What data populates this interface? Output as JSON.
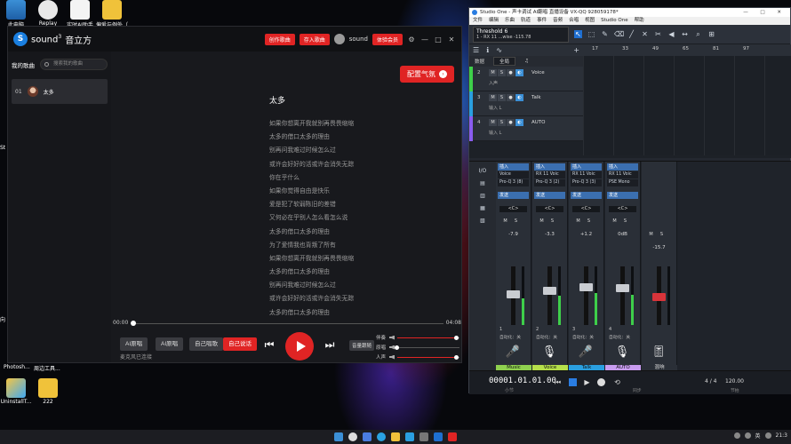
{
  "desktop": {
    "icons": [
      {
        "label": "此电脑"
      },
      {
        "label": "Replay"
      },
      {
        "label": "实时AI助手"
      },
      {
        "label": "偏爱与例外（"
      }
    ],
    "bottom_labels": [
      "Photosh...",
      "周边工具..."
    ],
    "bottom_icons": [
      {
        "label": "UninstallT..."
      },
      {
        "label": "222"
      }
    ],
    "side_letters": [
      "St",
      "向"
    ]
  },
  "sound3": {
    "brand": "sound",
    "brand_sup": "3",
    "app_name": "音立方",
    "header_buttons": [
      "创作歌曲",
      "存入歌曲"
    ],
    "user_name": "sound",
    "vip_button": "体验会员",
    "window_controls": [
      "—",
      "□",
      "✕"
    ],
    "sidebar": {
      "title": "我的歌曲",
      "search_placeholder": "搜索我的歌曲",
      "songs": [
        {
          "num": "01",
          "name": "太多"
        }
      ]
    },
    "config_button": "配置气氛",
    "song_title": "太多",
    "lyrics": [
      "如果你想离开我就别再畏畏缩缩",
      "太多的借口太多的理由",
      "别再问我难过时候怎么过",
      "或许会好好的活或许会消失无踪",
      "你在乎什么",
      "如果你觉得自由是快乐",
      "爱是犯了软弱陈旧的差错",
      "又何必在乎别人怎么看怎么说",
      "太多的借口太多的理由",
      "为了爱情我也背叛了所有",
      "如果你想离开我就别再畏畏缩缩",
      "太多的借口太多的理由",
      "别再问我难过时候怎么过",
      "或许会好好的活或许会消失无踪",
      "太多的借口太多的理由"
    ],
    "time_start": "00:00",
    "time_end": "04:08",
    "progress": 0.0,
    "buttons": [
      "AI原唱",
      "AI原唱",
      "自己唱歌",
      "自己说话"
    ],
    "status": "麦克风已连接",
    "audio_button": "音量跟随",
    "mix": [
      {
        "label": "伴奏",
        "level": 0.95
      },
      {
        "label": "原唱",
        "level": 0.0
      },
      {
        "label": "人声",
        "level": 0.95
      }
    ],
    "colors": {
      "accent": "#e02424",
      "bg": "#18191d"
    }
  },
  "studio_one": {
    "title": "Studio One - 声卡调试 AI翻唱 直播设备 VX-QQ 928059178*",
    "window_controls": "— □ ✕",
    "menu": [
      "文件",
      "编辑",
      "乐曲",
      "轨道",
      "事件",
      "音频",
      "合唱",
      "视图",
      "Studio One",
      "帮助"
    ],
    "preset_name": "Threshold 6",
    "preset_sub": "1 - RX 11 ...wise         -115.78",
    "ruler": [
      "17",
      "33",
      "49",
      "65",
      "81",
      "97"
    ],
    "arrange_head": [
      "数据",
      "全局"
    ],
    "tracks": [
      {
        "num": "2",
        "name": "Voice",
        "sub": "入声",
        "color": "#3ecf4a"
      },
      {
        "num": "3",
        "name": "Talk",
        "sub": "输入 L",
        "color": "#2a9fe0"
      },
      {
        "num": "4",
        "name": "AUTO",
        "sub": "输入 L",
        "color": "#8a5cf0"
      }
    ],
    "mixer_side": [
      "I/O",
      "▤",
      "▥",
      "▦",
      "▧"
    ],
    "strips": [
      {
        "ins": [
          "Voice",
          "Pro-Q 3 (8)"
        ],
        "db": "-7.9",
        "num": "1",
        "auto": "自动化：关",
        "label": "Music",
        "label_color": "#8fd14f",
        "icon": "🎤",
        "fader": 0.55,
        "meter": 0.45,
        "red": false
      },
      {
        "ins": [
          "RX 11 Voic",
          "Pro-Q 3 (2)"
        ],
        "db": "-3.3",
        "num": "2",
        "auto": "自动化：关",
        "label": "Voice",
        "label_color": "#b6e04a",
        "icon": "🎙",
        "fader": 0.62,
        "meter": 0.5,
        "red": false
      },
      {
        "ins": [
          "RX 11 Voic",
          "Pro-Q 3 (3)"
        ],
        "db": "+1.2",
        "num": "3",
        "auto": "自动化：关",
        "label": "Talk",
        "label_color": "#2a9fe0",
        "icon": "🎤",
        "fader": 0.68,
        "meter": 0.55,
        "red": false
      },
      {
        "ins": [
          "RX 11 Voic",
          "PSE Mono"
        ],
        "db": "0dB",
        "num": "4",
        "auto": "自动化：关",
        "label": "AUTO",
        "label_color": "#c89cf0",
        "icon": "🎙",
        "fader": 0.67,
        "meter": 0.52,
        "red": false
      },
      {
        "ins": [],
        "db": "-15.7",
        "num": "",
        "auto": "",
        "label": "混响",
        "label_color": "#2a2f37",
        "icon": "🎚",
        "fader": 0.5,
        "meter": 0.0,
        "red": true
      }
    ],
    "send_label": "发送",
    "insert_label": "插入",
    "pan_label": "<C>",
    "transport": {
      "time": "00001.01.01.00",
      "sub": "小节",
      "sync": "同步",
      "tempo_sig": "4 / 4",
      "tempo": "120.00",
      "tempo_label": "节拍"
    }
  },
  "taskbar": {
    "tray_text": "英",
    "clock": "21:3"
  }
}
